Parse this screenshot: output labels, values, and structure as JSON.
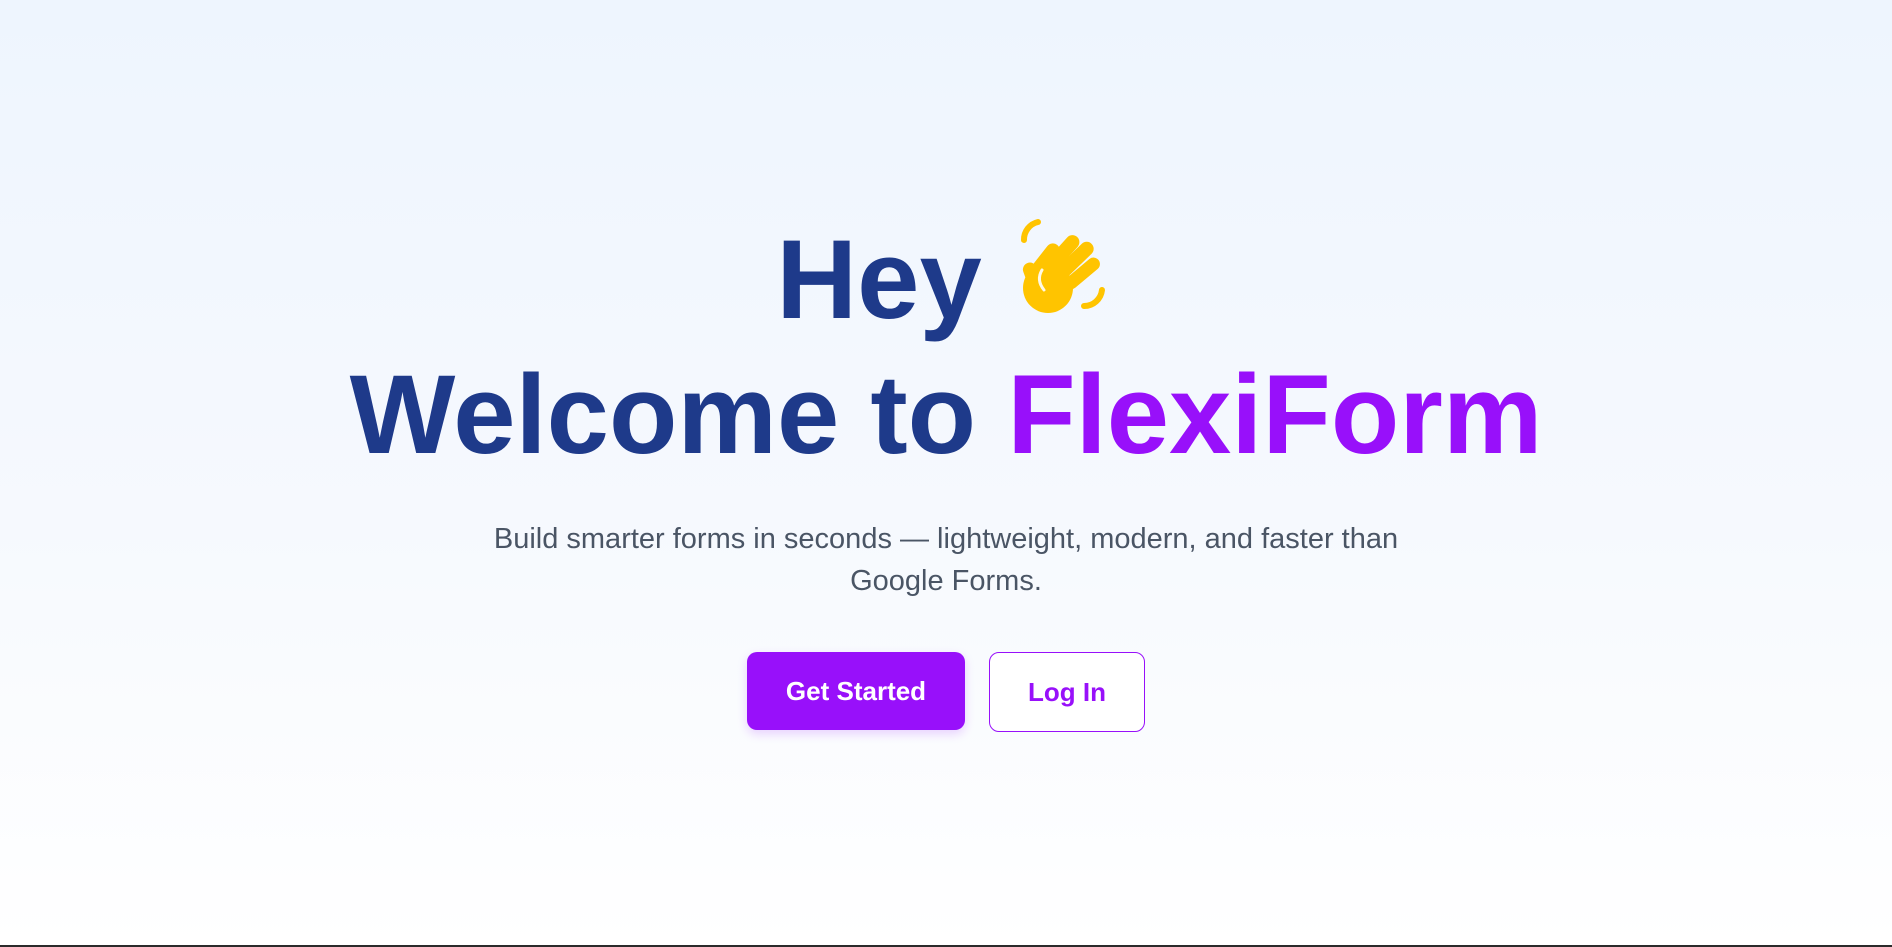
{
  "hero": {
    "greeting": "Hey",
    "greeting_icon": "waving-hand-icon",
    "welcome_prefix": "Welcome to",
    "brand_name": "FlexiForm",
    "subtitle": "Build smarter forms in seconds — lightweight, modern, and faster than Google Forms."
  },
  "actions": {
    "primary_label": "Get Started",
    "secondary_label": "Log In"
  },
  "colors": {
    "heading": "#1e3a8a",
    "brand": "#9810fa",
    "subtitle": "#4a5565",
    "wave_icon": "#ffc400"
  }
}
